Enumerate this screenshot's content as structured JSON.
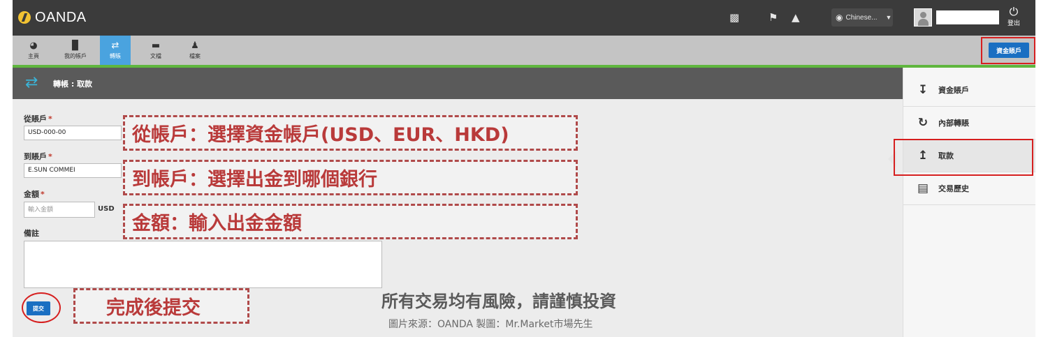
{
  "topbar": {
    "logo_text": "OANDA",
    "icons": [
      "monitor-icon",
      "flag-icon",
      "warning-icon"
    ],
    "language": "Chinese...",
    "logout_label": "登出"
  },
  "nav": {
    "items": [
      {
        "icon": "dashboard-icon",
        "label": "主頁",
        "active": false
      },
      {
        "icon": "bar-chart-icon",
        "label": "我的帳戶",
        "active": false
      },
      {
        "icon": "transfer-icon",
        "label": "轉賬",
        "active": true
      },
      {
        "icon": "folder-icon",
        "label": "文檔",
        "active": false
      },
      {
        "icon": "profile-icon",
        "label": "檔案",
        "active": false
      }
    ],
    "fund_button": "資金賬戶"
  },
  "page": {
    "title": "轉帳 : 取款"
  },
  "form": {
    "from_label": "從賬戶",
    "from_value": "USD-000-00",
    "to_label": "到賬戶",
    "to_value": "E.SUN COMMEI",
    "amount_label": "金額",
    "amount_placeholder": "輸入金額",
    "currency": "USD",
    "note_label": "備註",
    "required_mark": "*",
    "submit_label": "提交"
  },
  "annotations": {
    "from": "從帳戶：選擇資金帳戶(USD、EUR、HKD)",
    "to": "到帳戶：選擇出金到哪個銀行",
    "amount": "金額：輸入出金金額",
    "submit": "完成後提交",
    "disclaimer": "所有交易均有風險，請謹慎投資",
    "source": "圖片來源：OANDA 製圖：Mr.Market市場先生"
  },
  "side": {
    "items": [
      {
        "icon": "fund-account-icon",
        "label": "資金賬戶",
        "active": false
      },
      {
        "icon": "internal-transfer-icon",
        "label": "內部轉賬",
        "active": false
      },
      {
        "icon": "withdraw-icon",
        "label": "取款",
        "active": true
      },
      {
        "icon": "history-icon",
        "label": "交易歷史",
        "active": false
      }
    ]
  }
}
